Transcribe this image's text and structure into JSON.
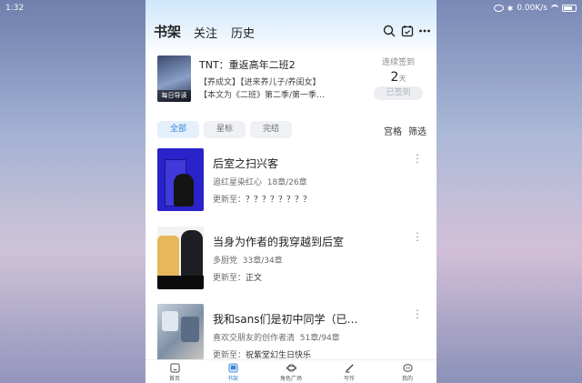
{
  "status": {
    "time": "1:32",
    "speed": "0.00K/s"
  },
  "header": {
    "tabs": [
      {
        "label": "书架",
        "active": true
      },
      {
        "label": "关注",
        "active": false
      },
      {
        "label": "历史",
        "active": false
      }
    ],
    "icons": [
      "search-icon",
      "calendar-check-icon",
      "more-icon"
    ]
  },
  "banner": {
    "cover_tag": "每日导读",
    "title": "TNT：重返高年二班2",
    "line1": "【养成文】【进来养儿子/养闺女】",
    "line2": "【本文为《二班》第二季/第一季…",
    "signin_label": "连续签到",
    "signin_days": "2",
    "signin_unit": "天",
    "signin_button": "已签到"
  },
  "filters": {
    "chips": [
      {
        "label": "全部",
        "active": true
      },
      {
        "label": "星标",
        "active": false
      },
      {
        "label": "完结",
        "active": false
      }
    ],
    "grid_label": "宫格",
    "filter_label": "筛选"
  },
  "books": [
    {
      "title": "后室之扫兴客",
      "author": "追红星染红心",
      "progress": "18章/26章",
      "update_prefix": "更新至：",
      "update": "？？？？？？？？"
    },
    {
      "title": "当身为作者的我穿越到后室",
      "author": "多厨党",
      "progress": "33章/34章",
      "update_prefix": "更新至：",
      "update": "正文"
    },
    {
      "title": "我和sans们是初中同学（已…",
      "author": "喜欢交朋友的创作者清",
      "progress": "51章/94章",
      "update_prefix": "更新至：",
      "update": "祝紫堂幻生日快乐"
    }
  ],
  "bottom_nav": [
    {
      "label": "首页",
      "icon": "home-icon",
      "active": false
    },
    {
      "label": "书架",
      "icon": "bookshelf-icon",
      "active": true
    },
    {
      "label": "角色广场",
      "icon": "planet-icon",
      "active": false
    },
    {
      "label": "写作",
      "icon": "pen-icon",
      "active": false
    },
    {
      "label": "我的",
      "icon": "profile-icon",
      "active": false
    }
  ],
  "colors": {
    "accent": "#3a86d8",
    "top_gradient": "#cfe6fb"
  }
}
